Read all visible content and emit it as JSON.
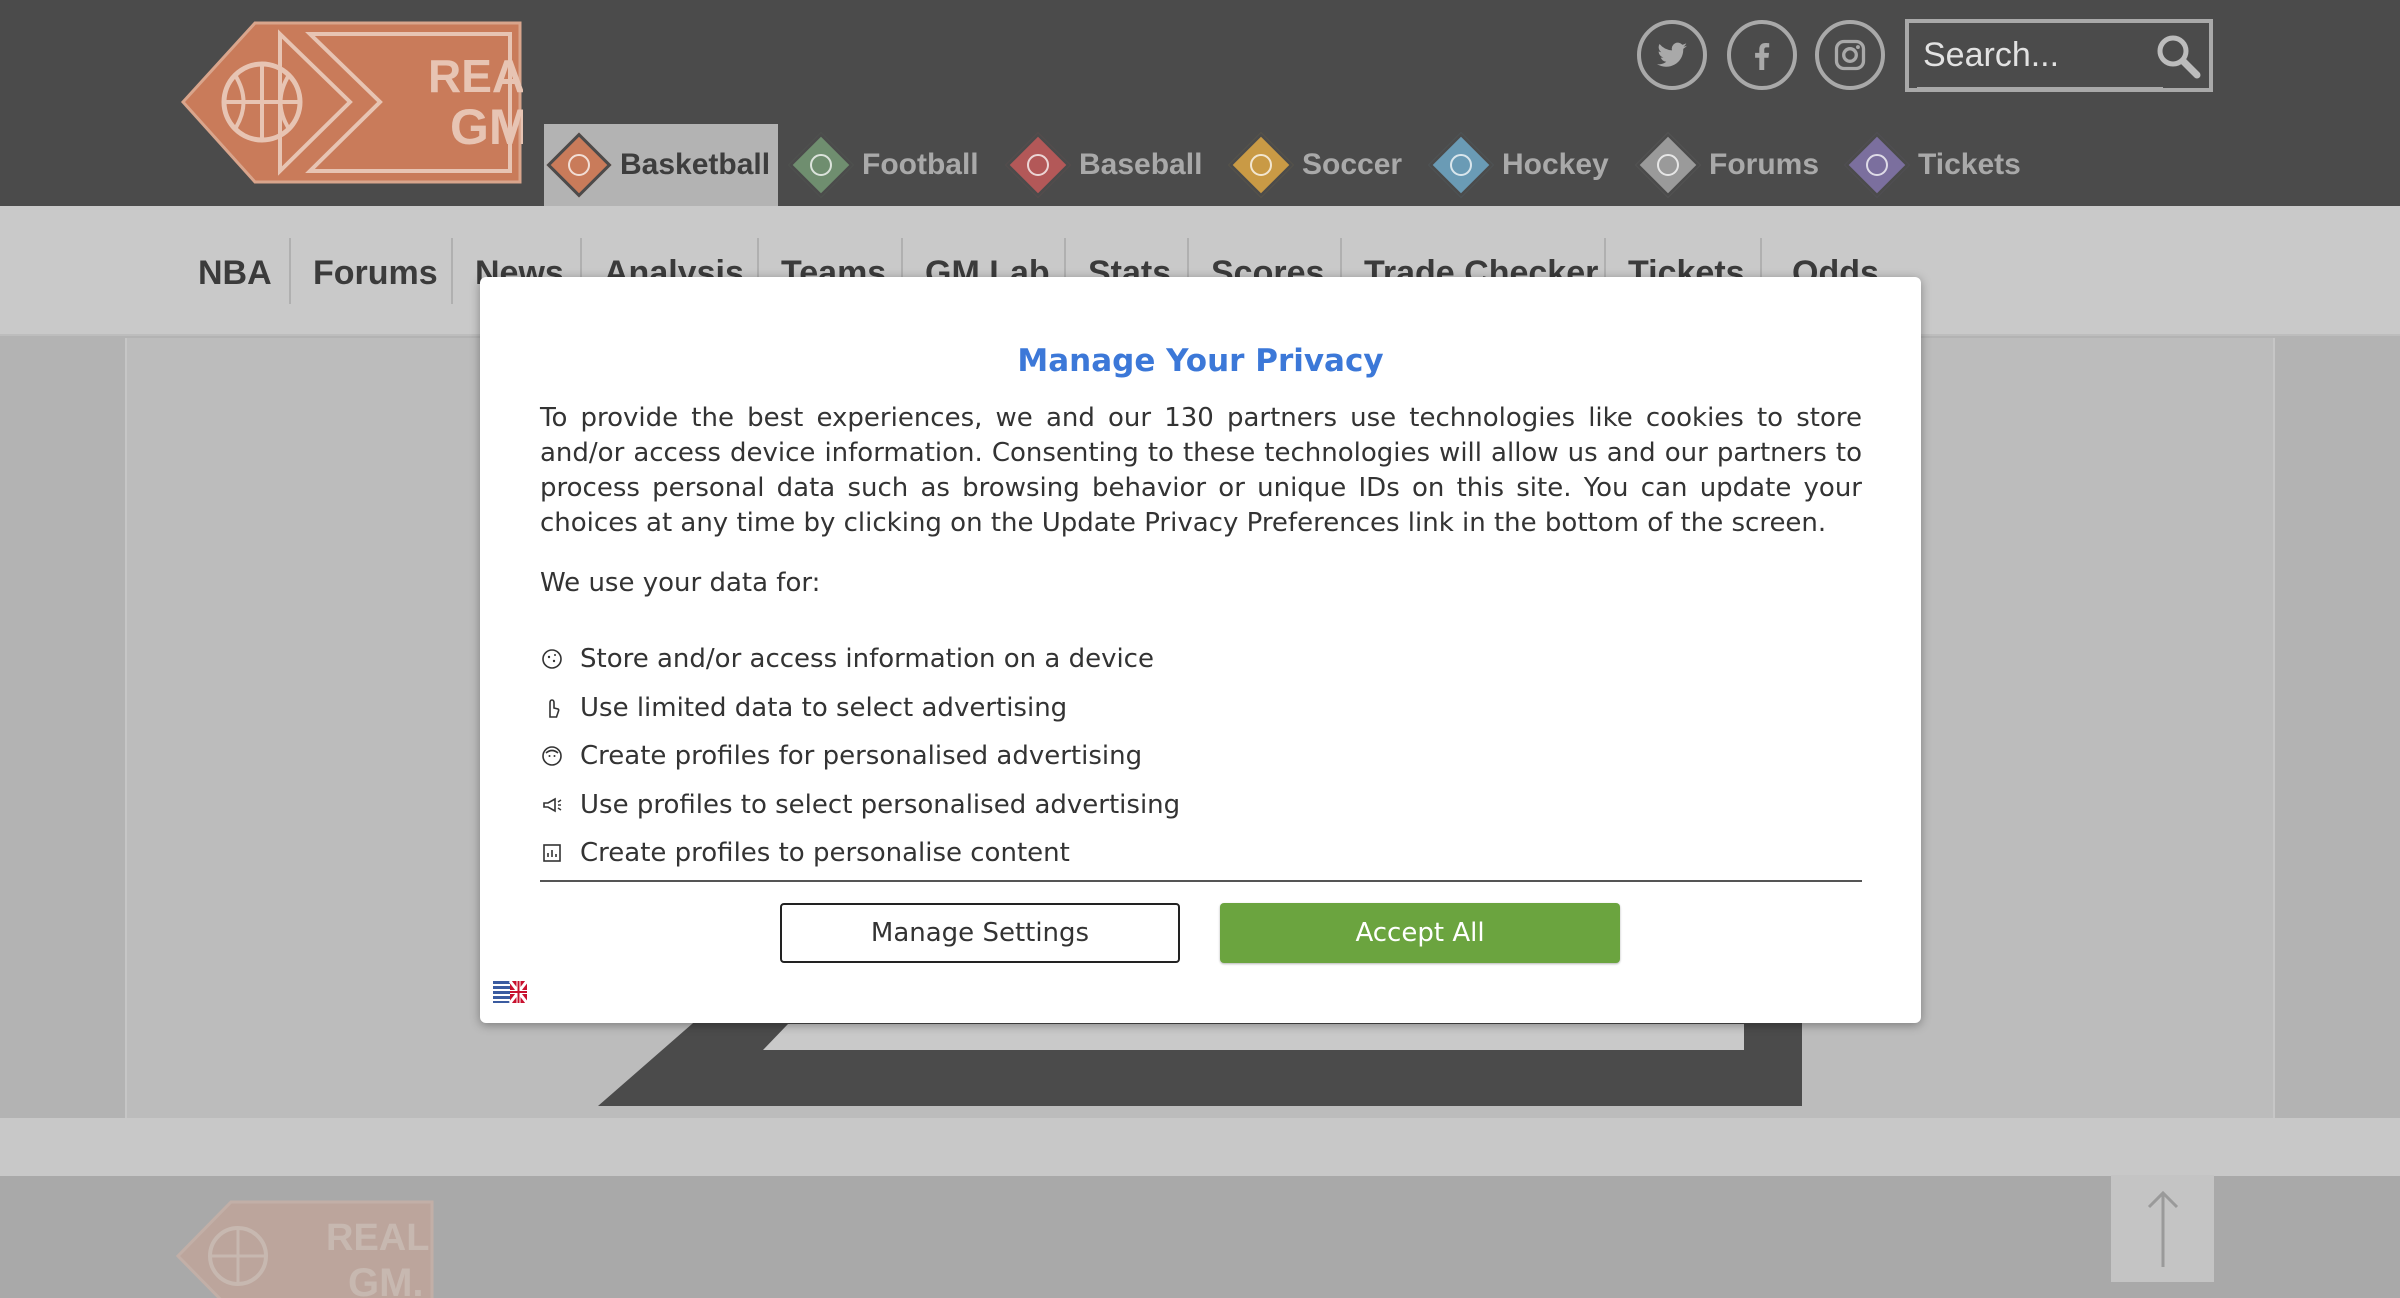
{
  "header": {
    "logo_text": "REAL GM.",
    "search": {
      "placeholder": "Search..."
    },
    "social": [
      "twitter-icon",
      "facebook-icon",
      "instagram-icon"
    ],
    "sports": [
      {
        "label": "Basketball",
        "icon": "basketball-icon",
        "color": "#c97b5a",
        "active": true
      },
      {
        "label": "Football",
        "icon": "football-icon",
        "color": "#6f8e6f",
        "active": false
      },
      {
        "label": "Baseball",
        "icon": "baseball-icon",
        "color": "#b35858",
        "active": false
      },
      {
        "label": "Soccer",
        "icon": "soccer-icon",
        "color": "#c99a45",
        "active": false
      },
      {
        "label": "Hockey",
        "icon": "hockey-icon",
        "color": "#6a9bb5",
        "active": false
      },
      {
        "label": "Forums",
        "icon": "forums-icon",
        "color": "#9a9a9a",
        "active": false
      },
      {
        "label": "Tickets",
        "icon": "tickets-icon",
        "color": "#7b6f9e",
        "active": false
      }
    ]
  },
  "subnav": {
    "items": [
      "NBA",
      "Forums",
      "News",
      "Analysis",
      "Teams",
      "GM Lab",
      "Stats",
      "Scores",
      "Trade Checker",
      "Tickets",
      "Odds"
    ]
  },
  "privacy_modal": {
    "title": "Manage Your Privacy",
    "body": "To provide the best experiences, we and our 130 partners use technologies like cookies to store and/or access device information. Consenting to these technologies will allow us and our partners to process personal data such as browsing behavior or unique IDs on this site. You can update your choices at any time by clicking on the Update Privacy Preferences link in the bottom of the screen.",
    "subtitle": "We use your data for:",
    "purposes": [
      {
        "label": "Store and/or access information on a device",
        "icon": "cookie-icon"
      },
      {
        "label": "Use limited data to select advertising",
        "icon": "pointer-hand-icon"
      },
      {
        "label": "Create profiles for personalised advertising",
        "icon": "profile-icon"
      },
      {
        "label": "Use profiles to select personalised advertising",
        "icon": "megaphone-icon"
      },
      {
        "label": "Create profiles to personalise content",
        "icon": "content-icon"
      }
    ],
    "manage_label": "Manage Settings",
    "accept_label": "Accept All",
    "accent_color": "#3c78d8",
    "accept_color": "#6ba43f"
  }
}
